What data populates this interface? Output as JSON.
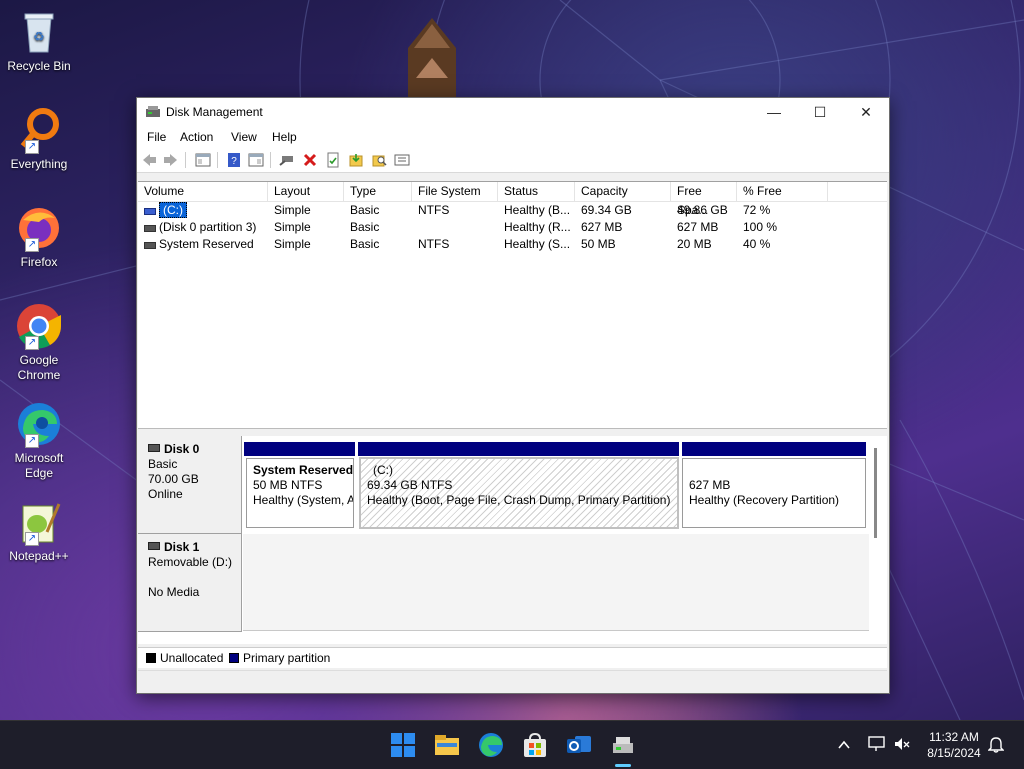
{
  "desktop": {
    "icons": [
      {
        "label": "Recycle Bin"
      },
      {
        "label": "Everything"
      },
      {
        "label": "Firefox"
      },
      {
        "label": "Google Chrome"
      },
      {
        "label": "Microsoft Edge"
      },
      {
        "label": "Notepad++"
      }
    ]
  },
  "window": {
    "title": "Disk Management",
    "controls": {
      "minimize": "—",
      "maximize": "☐",
      "close": "✕"
    },
    "menu": [
      "File",
      "Action",
      "View",
      "Help"
    ],
    "columns": [
      "Volume",
      "Layout",
      "Type",
      "File System",
      "Status",
      "Capacity",
      "Free Spa...",
      "% Free"
    ],
    "volumes": [
      {
        "name": "(C:)",
        "layout": "Simple",
        "type": "Basic",
        "fs": "NTFS",
        "status": "Healthy (B...",
        "capacity": "69.34 GB",
        "free": "49.86 GB",
        "pct": "72 %"
      },
      {
        "name": "(Disk 0 partition 3)",
        "layout": "Simple",
        "type": "Basic",
        "fs": "",
        "status": "Healthy (R...",
        "capacity": "627 MB",
        "free": "627 MB",
        "pct": "100 %"
      },
      {
        "name": "System Reserved",
        "layout": "Simple",
        "type": "Basic",
        "fs": "NTFS",
        "status": "Healthy (S...",
        "capacity": "50 MB",
        "free": "20 MB",
        "pct": "40 %"
      }
    ],
    "disks": [
      {
        "name": "Disk 0",
        "type": "Basic",
        "size": "70.00 GB",
        "state": "Online",
        "partitions": [
          {
            "title": "System Reserved",
            "detail": "50 MB NTFS",
            "status": "Healthy (System, Active, Primary Partition)"
          },
          {
            "title": "(C:)",
            "detail": "69.34 GB NTFS",
            "status": "Healthy (Boot, Page File, Crash Dump, Primary Partition)"
          },
          {
            "title": "",
            "detail": "627 MB",
            "status": "Healthy (Recovery Partition)"
          }
        ]
      },
      {
        "name": "Disk 1",
        "type": "Removable (D:)",
        "size": "",
        "state": "No Media"
      }
    ],
    "legend": {
      "unallocated": "Unallocated",
      "primary": "Primary partition"
    },
    "colors": {
      "primary": "#00007f",
      "unallocated": "#000000"
    }
  },
  "taskbar": {
    "clock_time": "11:32 AM",
    "clock_date": "8/15/2024",
    "apps": [
      "start-icon",
      "file-explorer-icon",
      "edge-icon",
      "store-icon",
      "outlook-icon",
      "disk-management-icon"
    ]
  }
}
